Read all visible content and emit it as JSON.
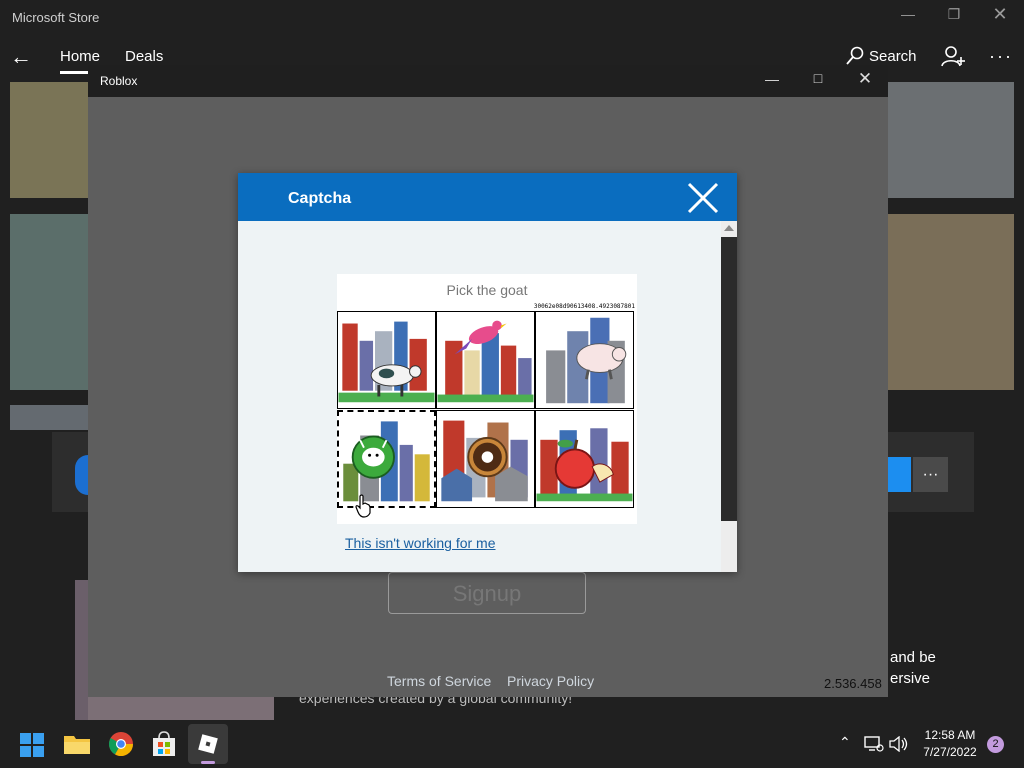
{
  "store": {
    "title": "Microsoft Store",
    "nav": [
      "Home",
      "Deals"
    ],
    "search_label": "Search",
    "desc_line1": "and be",
    "desc_line2": "ersive",
    "desc_line3": "experiences created by a global community!"
  },
  "roblox_window": {
    "title": "Roblox",
    "signup_label": "Signup",
    "terms_label": "Terms of Service",
    "privacy_label": "Privacy Policy",
    "version": "2.536.458"
  },
  "captcha": {
    "title": "Captcha",
    "prompt": "Pick the goat",
    "session_id": "30062e08d90613408.4923087801",
    "fallback_link": "This isn't working for me",
    "tiles": [
      "cow",
      "bird",
      "pig",
      "goat",
      "donut",
      "apple"
    ],
    "selected_index": 3
  },
  "taskbar": {
    "time": "12:58 AM",
    "date": "7/27/2022",
    "notification_count": "2"
  },
  "colors": {
    "captcha_header": "#0a6dbf",
    "link": "#1a5fa0",
    "badge": "#c39bde"
  }
}
